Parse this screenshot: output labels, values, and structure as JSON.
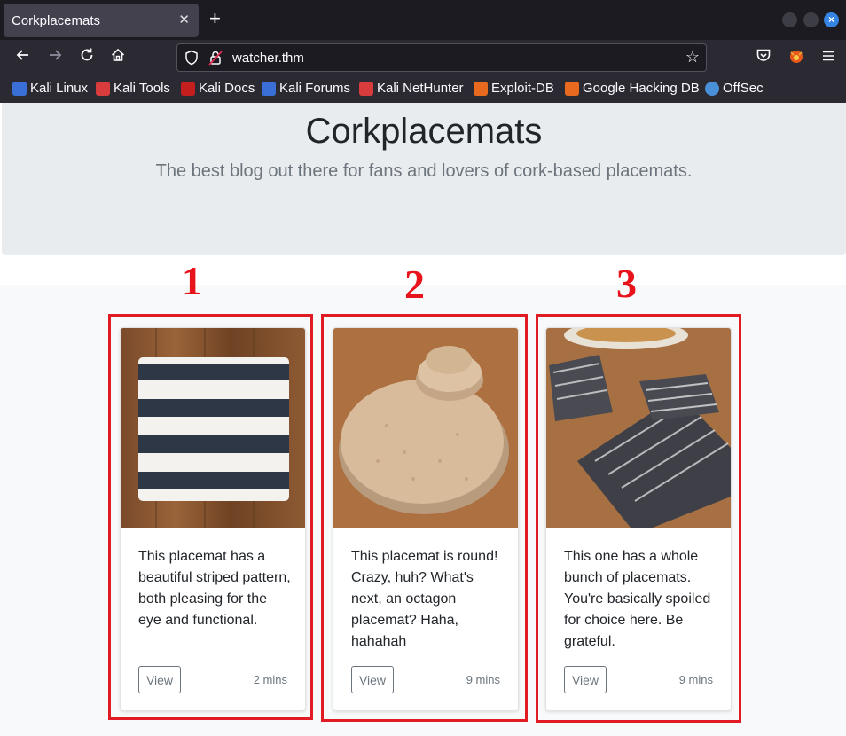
{
  "browser": {
    "tab_title": "Corkplacemats",
    "tab_close": "✕",
    "new_tab": "+",
    "url": "watcher.thm",
    "bookmarks": [
      {
        "label": "Kali Linux",
        "color": "#3b6fd8"
      },
      {
        "label": "Kali Tools",
        "color": "#d93c3c"
      },
      {
        "label": "Kali Docs",
        "color": "#c41e1e"
      },
      {
        "label": "Kali Forums",
        "color": "#3b6fd8"
      },
      {
        "label": "Kali NetHunter",
        "color": "#d93c3c"
      },
      {
        "label": "Exploit-DB",
        "color": "#e86a1f"
      },
      {
        "label": "Google Hacking DB",
        "color": "#e86a1f"
      },
      {
        "label": "OffSec",
        "color": "#4a90d9"
      }
    ]
  },
  "header": {
    "title": "Corkplacemats",
    "subtitle": "The best blog out there for fans and lovers of cork-based placemats."
  },
  "annotations": [
    "1",
    "2",
    "3"
  ],
  "cards": [
    {
      "text": "This placemat has a beautiful striped pattern, both pleasing for the eye and functional.",
      "button": "View",
      "time": "2 mins"
    },
    {
      "text": "This placemat is round! Crazy, huh? What's next, an octagon placemat? Haha, hahahah",
      "button": "View",
      "time": "9 mins"
    },
    {
      "text": "This one has a whole bunch of placemats. You're basically spoiled for choice here. Be grateful.",
      "button": "View",
      "time": "9 mins"
    }
  ],
  "colors": {
    "annotation_red": "#e01b24",
    "jumbotron_bg": "#e9ecef",
    "muted_text": "#6c757d"
  }
}
